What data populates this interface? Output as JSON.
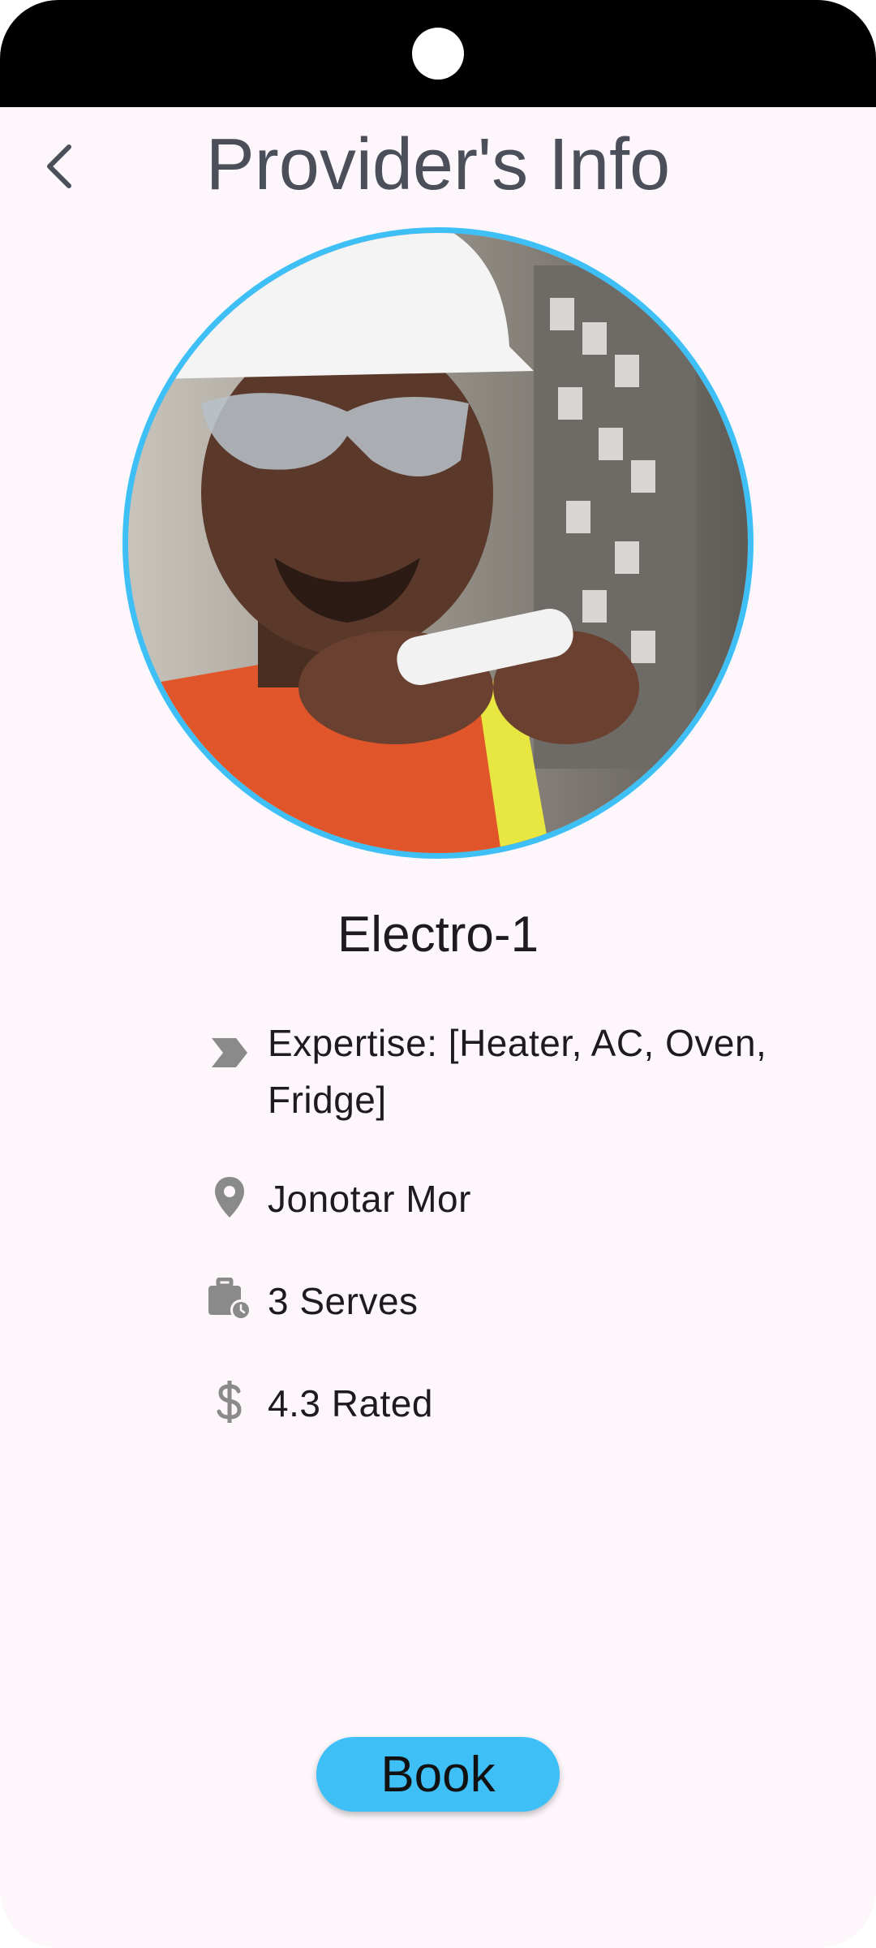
{
  "header": {
    "title": "Provider's Info",
    "back_icon": "chevron-left-icon"
  },
  "provider": {
    "photo": "electrician-photo",
    "name": "Electro-1",
    "expertise": "Expertise: [Heater, AC, Oven, Fridge]",
    "location": "Jonotar Mor",
    "serves": "3 Serves",
    "rating": "4.3 Rated"
  },
  "icons": {
    "expertise": "label-tag-icon",
    "location": "location-pin-icon",
    "serves": "work-history-icon",
    "rating": "dollar-icon"
  },
  "actions": {
    "book_label": "Book"
  },
  "colors": {
    "accent": "#3ec0f7",
    "background": "#fdf7fb",
    "title": "#4a4f5a",
    "icon": "#8a8a8a"
  }
}
